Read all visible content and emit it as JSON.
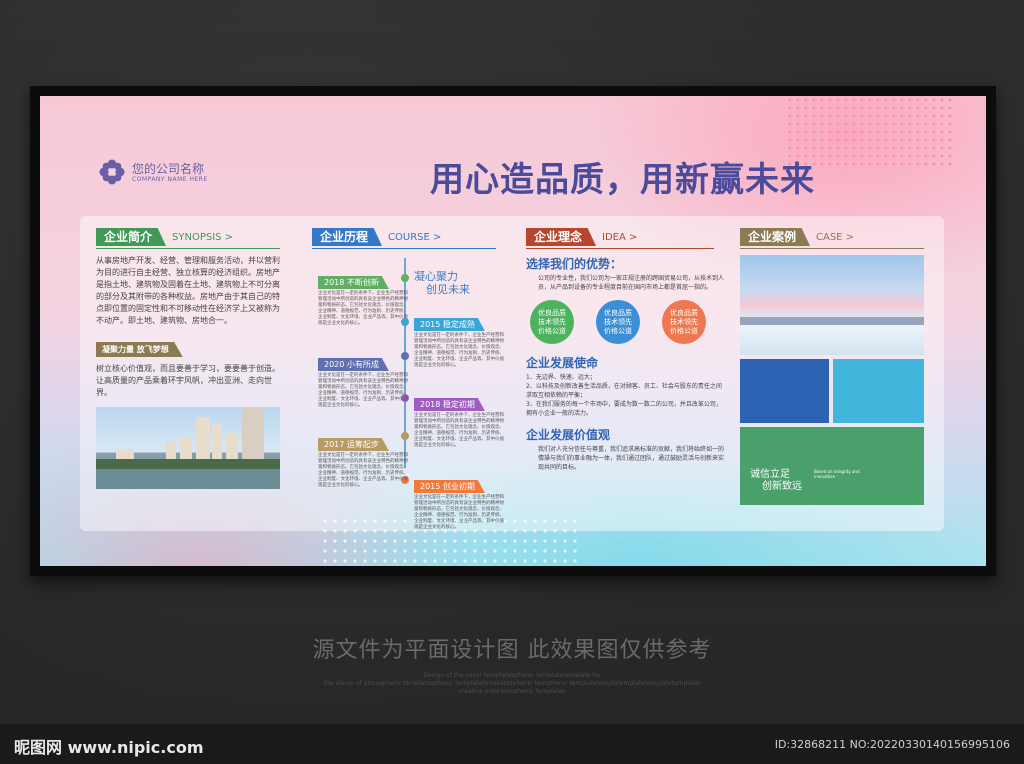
{
  "company": {
    "name_cn": "您的公司名称",
    "name_en": "COMPANY NAME HERE"
  },
  "slogan": "用心造品质，用新赢未来",
  "synopsis": {
    "title": "企业简介",
    "title_en": "SYNOPSIS >",
    "body": "从事房地产开发、经营、管理和服务活动，并以营利为目的进行自主经营、独立核算的经济组织。房地产是指土地、建筑物及固着在土地、建筑物上不可分离的部分及其附带的各种权益。房地产由于其自己的特点即位置的固定性和不可移动性在经济学上又被称为不动产。即土地、建筑物、房地合一。",
    "sub_title": "凝聚力量 放飞梦想",
    "sub_body": "树立核心价值观，而且要善于学习，要要善于创造。让高质量的产品乘着环宇风帆，冲出亚洲、走向世界。"
  },
  "course": {
    "title": "企业历程",
    "title_en": "COURSE >",
    "motto": [
      "凝心聚力",
      "创见未来"
    ],
    "item_text": "企业文化是在一定的条件下，企业生产经营和管理活动中所创造的具有该企业特色的精神财富和物质形态。它包括文化观念、价值观念、企业精神、道德规范、行为准则、历史传统、企业制度、文化环境、企业产品等。其中价值观是企业文化的核心。",
    "items": [
      {
        "label": "2018 不断创新",
        "color": "#5fae62"
      },
      {
        "label": "2015 稳定成熟",
        "color": "#3aa6d8"
      },
      {
        "label": "2020 小有所成",
        "color": "#5f6faf"
      },
      {
        "label": "2018 稳定初期",
        "color": "#a05cc0"
      },
      {
        "label": "2017 运筹起步",
        "color": "#b89a62"
      },
      {
        "label": "2015 创业初期",
        "color": "#f07a3c"
      }
    ]
  },
  "idea": {
    "title": "企业理念",
    "title_en": "IDEA >",
    "advantage_title": "选择我们的优势：",
    "advantage_body": "公司的专业性，我们公司为一家正规注册的跨国贸易公司，从技术到人员，从产品到设备的专业程度目前在国内市场上都是首屈一指的。",
    "circles": [
      {
        "text": [
          "优良品质",
          "技术领先",
          "价格公道"
        ],
        "color": "#4db35e"
      },
      {
        "text": [
          "优良品质",
          "技术领先",
          "价格公道"
        ],
        "color": "#3c8fd6"
      },
      {
        "text": [
          "优良品质",
          "技术领先",
          "价格公道"
        ],
        "color": "#f07850"
      }
    ],
    "mission_title": "企业发展使命",
    "mission_items": [
      "1、无边界、快速、远大；",
      "2、以科技及创新改善生活品质，在对顾客、员工、社会与股东的责任之间求取互相依赖的平衡；",
      "3、在我们服务的每一个市场中，要成为数一数二的公司，并且改革公司，拥有小企业一般的活力。"
    ],
    "values_title": "企业发展价值观",
    "values_body": "我们对人充分信任与尊重，我们追求高标准的贡献，我们将始终如一的情操与我们的事业融为一体，我们通过团队，通过鼓励灵活与创新来实现共同的目标。"
  },
  "case": {
    "title": "企业案例",
    "title_en": "CASE >",
    "green_cn": [
      "诚信立足",
      "创新致远"
    ],
    "green_en": "Based on integrity and innovation"
  },
  "watermark": {
    "title": "源文件为平面设计图 此效果图仅供参考",
    "en_lines": [
      "Design of the cover templatesphenic templatetemplate for",
      "the album of atmospheric templatosphenic templatetemplatosphenic teosphenic templatetemplatemplatetemplatetemplatel",
      "creative enterprosphenic templates"
    ]
  },
  "footer": {
    "logo": "昵图网 www.nipic.com",
    "id": "ID:32868211 NO:20220330140156995106"
  },
  "colors": {
    "green": "#3e9a55",
    "blue": "#3478c8",
    "brown": "#b5472e",
    "olive": "#8c7a52",
    "slogan": "#4b4b9c"
  }
}
